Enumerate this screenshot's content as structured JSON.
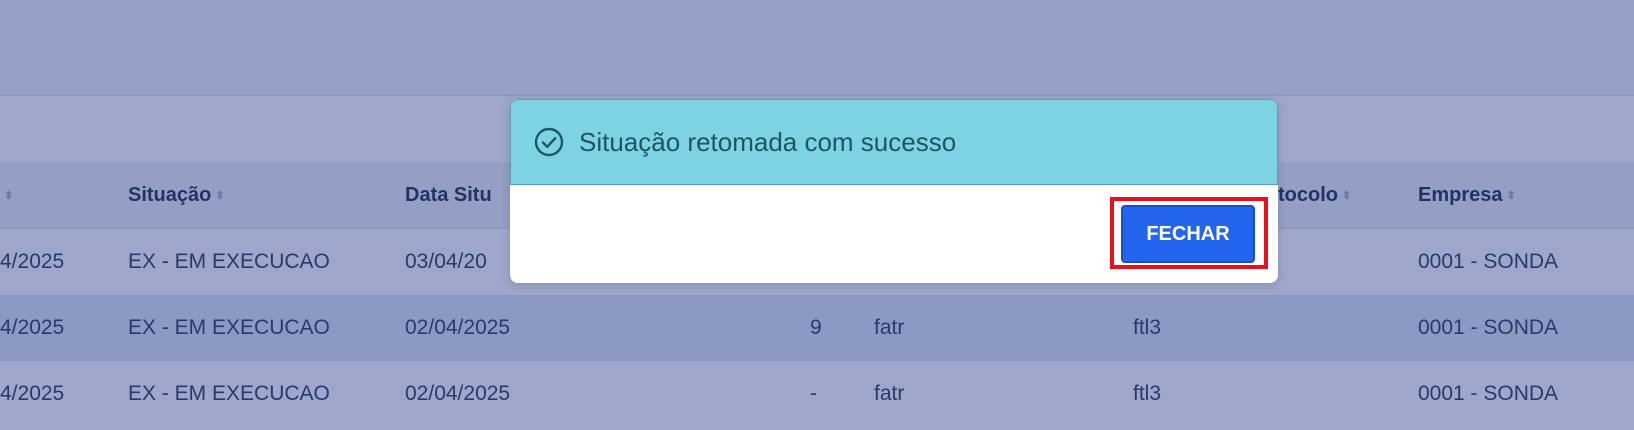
{
  "table": {
    "columns": [
      {
        "label": ""
      },
      {
        "label": "Situação"
      },
      {
        "label": "Data Situ"
      },
      {
        "label": "tocolo"
      },
      {
        "label": "Empresa"
      }
    ],
    "rows": [
      {
        "data": "4/2025",
        "situacao": "EX - EM EXECUCAO",
        "data_situacao": "03/04/20",
        "num": "",
        "usuario": "",
        "protocolo": "",
        "empresa": "0001 - SONDA"
      },
      {
        "data": "4/2025",
        "situacao": "EX - EM EXECUCAO",
        "data_situacao": "02/04/2025",
        "num": "9",
        "usuario": "fatr",
        "protocolo": "ftl3",
        "empresa": "0001 - SONDA"
      },
      {
        "data": "4/2025",
        "situacao": "EX - EM EXECUCAO",
        "data_situacao": "02/04/2025",
        "num": "-",
        "usuario": "fatr",
        "protocolo": "ftl3",
        "empresa": "0001 - SONDA"
      }
    ]
  },
  "modal": {
    "message": "Situação retomada com sucesso",
    "close_label": "FECHAR"
  },
  "icons": {
    "success": "check-circle-icon",
    "sort": "sort-icon"
  },
  "colors": {
    "alert_bg": "#7dd3e3",
    "alert_text": "#1d5662",
    "primary_button": "#2465ef",
    "highlight_border": "#e8101c"
  }
}
